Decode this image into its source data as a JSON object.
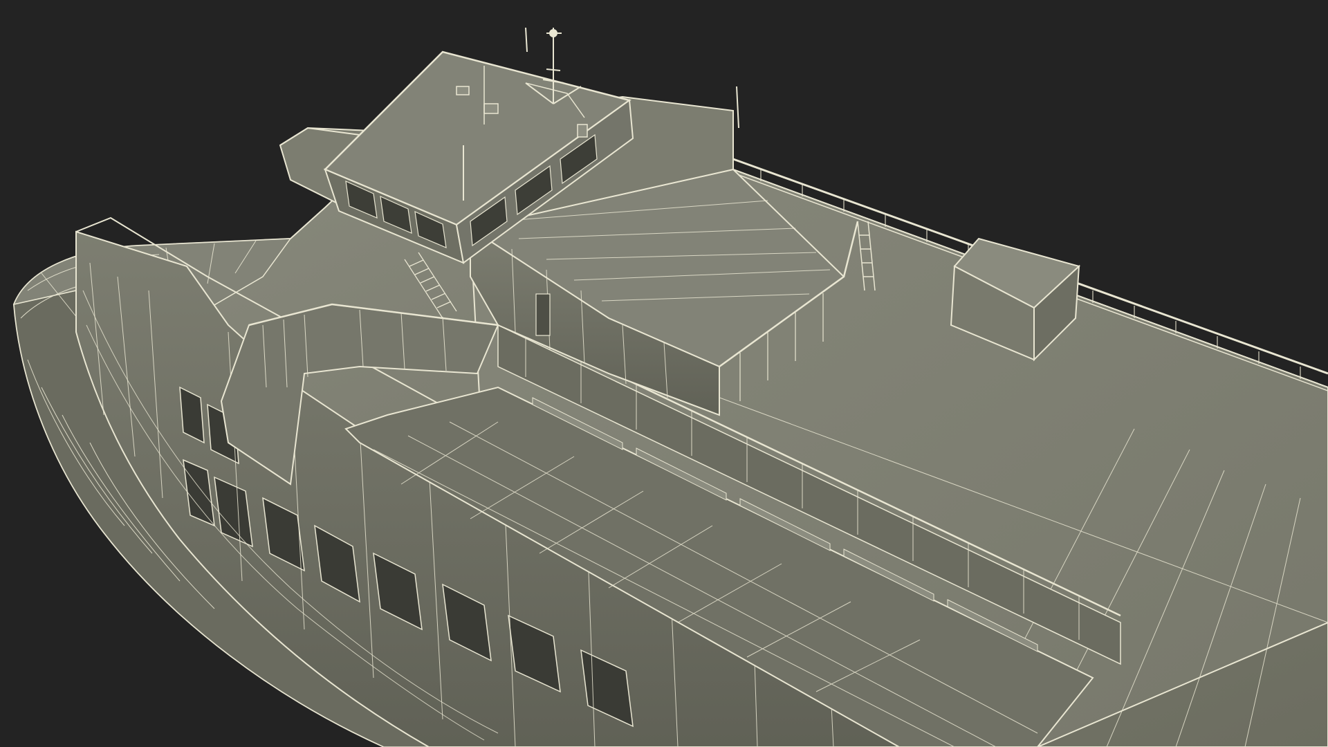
{
  "viewport": {
    "background_color": "#232323"
  },
  "model": {
    "subject": "ferry-ship-wireframe",
    "surface_color": "#7a7b6c",
    "surface_light_color": "#85867a",
    "surface_dark_color": "#5f6055",
    "wire_color": "#e9e6d2"
  }
}
